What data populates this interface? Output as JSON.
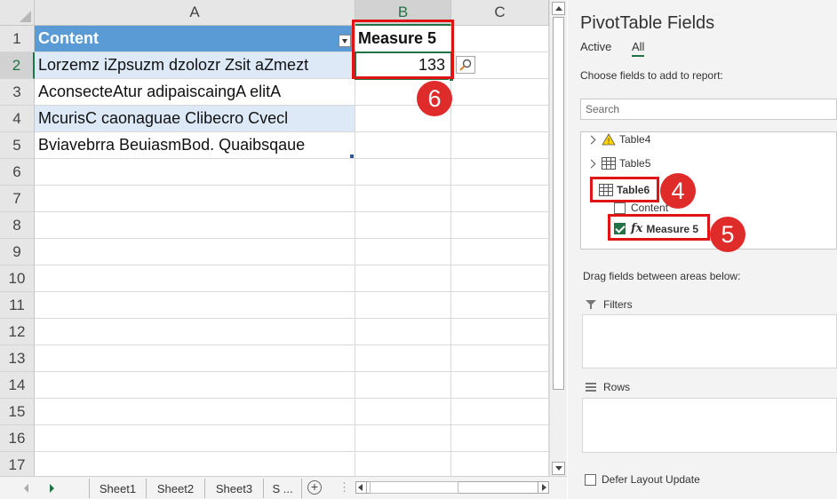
{
  "columns": [
    {
      "letter": "A",
      "selected": false
    },
    {
      "letter": "B",
      "selected": true
    },
    {
      "letter": "C",
      "selected": false
    }
  ],
  "rows": [
    "1",
    "2",
    "3",
    "4",
    "5",
    "6",
    "7",
    "8",
    "9",
    "10",
    "11",
    "12",
    "13",
    "14",
    "15",
    "16",
    "17"
  ],
  "selected_row": "2",
  "cells": {
    "A1": "Content",
    "B1": "Measure 5",
    "A2": "Lorzemz iZpsuzm dzolozr Zsit aZmezt",
    "B2": "133",
    "A3": "AconsecteAtur adipaiscaingA elitA",
    "A4": "McurisC caonaguae Clibecro Cvecl",
    "A5": "Bviavebrra BeuiasmBod. Quaibsqaue"
  },
  "sheet_tabs": [
    "Sheet1",
    "Sheet2",
    "Sheet3",
    "S ..."
  ],
  "pane": {
    "title": "PivotTable Fields",
    "tabs": [
      "Active",
      "All"
    ],
    "active_tab": "All",
    "choose_label": "Choose fields to add to report:",
    "search_placeholder": "Search",
    "fields": {
      "table4": "Table4",
      "table5": "Table5",
      "table6": "Table6",
      "content": "Content",
      "measure5": "Measure 5"
    },
    "fx_symbol": "fx",
    "drag_label": "Drag fields between areas below:",
    "filters_label": "Filters",
    "rows_label": "Rows",
    "defer_label": "Defer Layout Update"
  },
  "annotations": [
    "4",
    "5",
    "6"
  ],
  "colors": {
    "table_header": "#5b9bd5",
    "band": "#dde9f6",
    "excel_green": "#217346",
    "annotation_red": "#e01414"
  }
}
